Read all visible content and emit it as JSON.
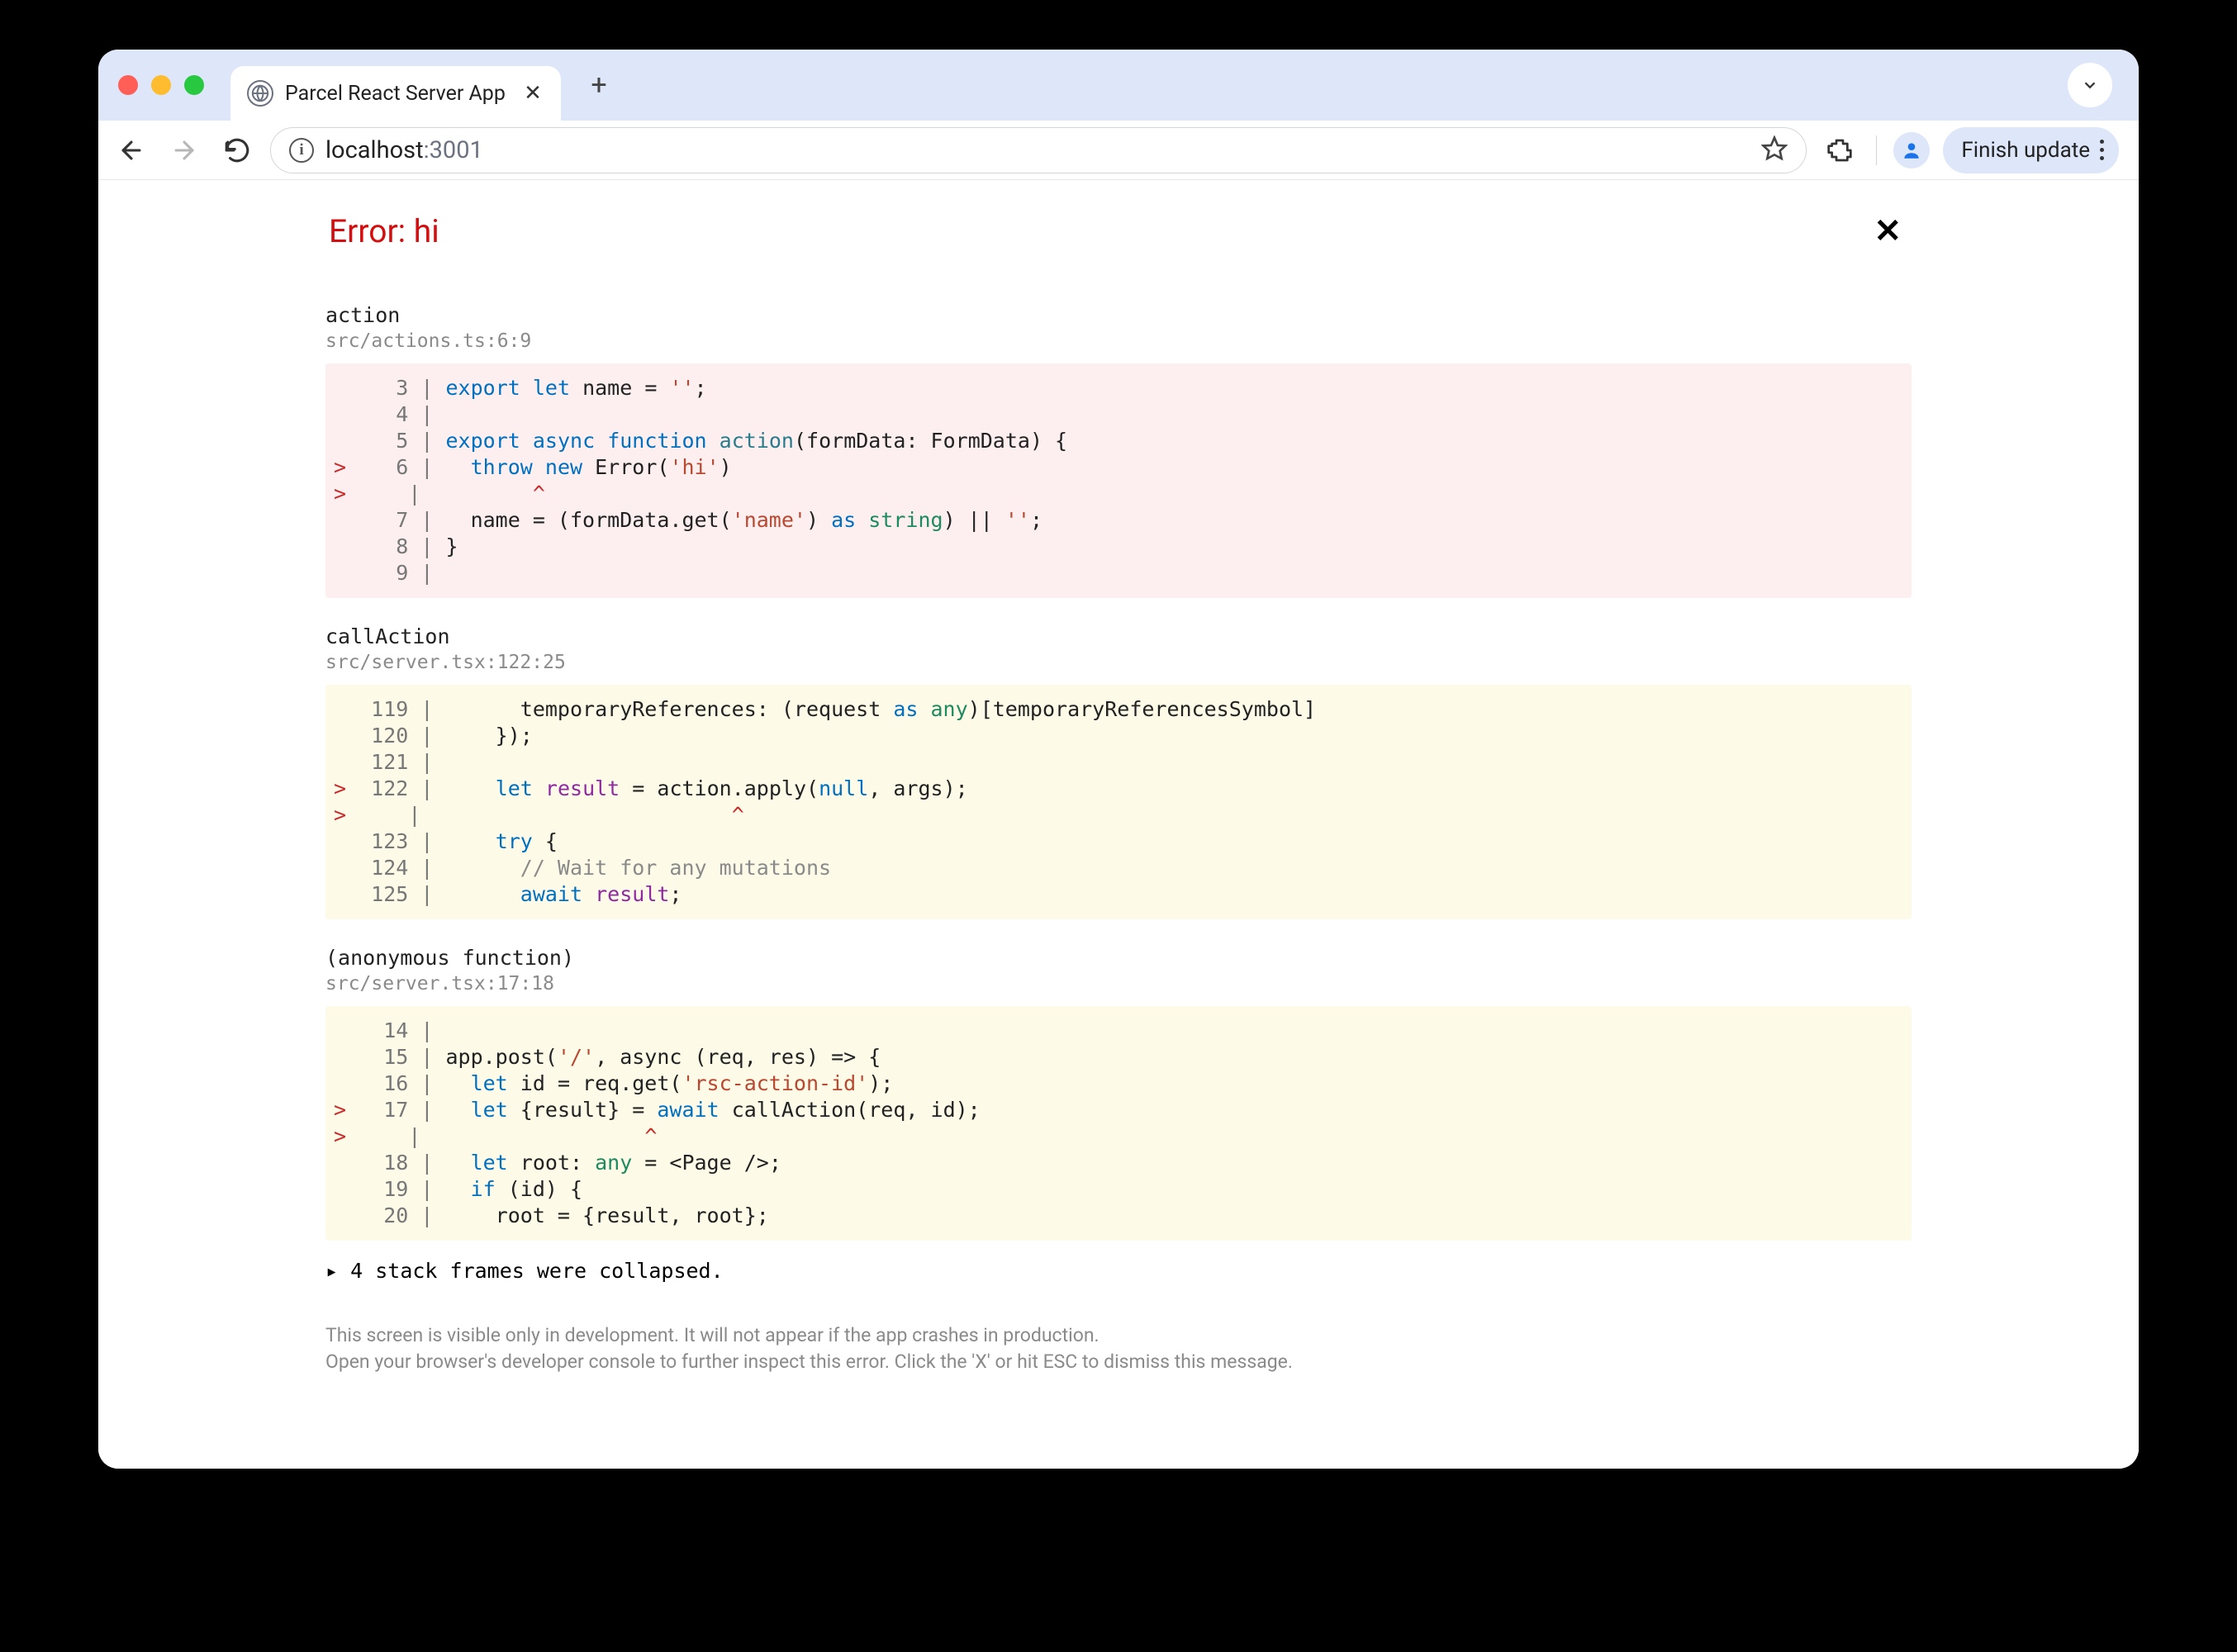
{
  "browser": {
    "tab_title": "Parcel React Server App",
    "url_host": "localhost",
    "url_port": ":3001",
    "finish_update": "Finish update"
  },
  "error": {
    "title": "Error: hi"
  },
  "frames": [
    {
      "name": "action",
      "loc": "src/actions.ts:6:9",
      "variant": "pink",
      "lines": [
        {
          "n": "3",
          "mark": " ",
          "tokens": [
            [
              "k-blue",
              "export"
            ],
            [
              "",
              " "
            ],
            [
              "k-blue",
              "let"
            ],
            [
              "",
              " name = "
            ],
            [
              "k-str",
              "''"
            ],
            [
              "",
              ";"
            ]
          ]
        },
        {
          "n": "4",
          "mark": " ",
          "tokens": []
        },
        {
          "n": "5",
          "mark": " ",
          "tokens": [
            [
              "k-blue",
              "export"
            ],
            [
              "",
              " "
            ],
            [
              "k-blue",
              "async"
            ],
            [
              "",
              " "
            ],
            [
              "k-blue",
              "function"
            ],
            [
              "",
              " "
            ],
            [
              "k-teal",
              "action"
            ],
            [
              "",
              "(formData: FormData) {"
            ]
          ]
        },
        {
          "n": "6",
          "mark": ">",
          "tokens": [
            [
              "",
              "  "
            ],
            [
              "k-blue",
              "throw"
            ],
            [
              "",
              " "
            ],
            [
              "k-blue",
              "new"
            ],
            [
              "",
              " Error("
            ],
            [
              "k-str",
              "'hi'"
            ],
            [
              "",
              ")"
            ]
          ]
        },
        {
          "caret": true,
          "col": 9
        },
        {
          "n": "7",
          "mark": " ",
          "tokens": [
            [
              "",
              "  name = (formData.get("
            ],
            [
              "k-str",
              "'name'"
            ],
            [
              "",
              ") "
            ],
            [
              "k-blue",
              "as"
            ],
            [
              "",
              " "
            ],
            [
              "k-any",
              "string"
            ],
            [
              "",
              ") || "
            ],
            [
              "k-str",
              "''"
            ],
            [
              "",
              ";"
            ]
          ]
        },
        {
          "n": "8",
          "mark": " ",
          "tokens": [
            [
              "",
              "}"
            ]
          ]
        },
        {
          "n": "9",
          "mark": " ",
          "tokens": []
        }
      ]
    },
    {
      "name": "callAction",
      "loc": "src/server.tsx:122:25",
      "variant": "yellow",
      "lines": [
        {
          "n": "119",
          "mark": " ",
          "tokens": [
            [
              "",
              "      temporaryReferences: (request "
            ],
            [
              "k-blue",
              "as"
            ],
            [
              "",
              " "
            ],
            [
              "k-any",
              "any"
            ],
            [
              "",
              ")[temporaryReferencesSymbol]"
            ]
          ]
        },
        {
          "n": "120",
          "mark": " ",
          "tokens": [
            [
              "",
              "    });"
            ]
          ]
        },
        {
          "n": "121",
          "mark": " ",
          "tokens": []
        },
        {
          "n": "122",
          "mark": ">",
          "tokens": [
            [
              "",
              "    "
            ],
            [
              "k-blue",
              "let"
            ],
            [
              "",
              " "
            ],
            [
              "k-purple",
              "result"
            ],
            [
              "",
              " = action.apply("
            ],
            [
              "k-blue",
              "null"
            ],
            [
              "",
              ", args);"
            ]
          ]
        },
        {
          "caret": true,
          "col": 25
        },
        {
          "n": "123",
          "mark": " ",
          "tokens": [
            [
              "",
              "    "
            ],
            [
              "k-blue",
              "try"
            ],
            [
              "",
              " {"
            ]
          ]
        },
        {
          "n": "124",
          "mark": " ",
          "tokens": [
            [
              "",
              "      "
            ],
            [
              "k-comment",
              "// Wait for any mutations"
            ]
          ]
        },
        {
          "n": "125",
          "mark": " ",
          "tokens": [
            [
              "",
              "      "
            ],
            [
              "k-blue",
              "await"
            ],
            [
              "",
              " "
            ],
            [
              "k-purple",
              "result"
            ],
            [
              "",
              ";"
            ]
          ]
        }
      ]
    },
    {
      "name": "(anonymous function)",
      "loc": "src/server.tsx:17:18",
      "variant": "yellow",
      "lines": [
        {
          "n": "14",
          "mark": " ",
          "tokens": []
        },
        {
          "n": "15",
          "mark": " ",
          "tokens": [
            [
              "",
              "app.post("
            ],
            [
              "k-str",
              "'/'"
            ],
            [
              "",
              ", async (req, res) => {"
            ]
          ]
        },
        {
          "n": "16",
          "mark": " ",
          "tokens": [
            [
              "",
              "  "
            ],
            [
              "k-blue",
              "let"
            ],
            [
              "",
              " id = req.get("
            ],
            [
              "k-str",
              "'rsc-action-id'"
            ],
            [
              "",
              ");"
            ]
          ]
        },
        {
          "n": "17",
          "mark": ">",
          "tokens": [
            [
              "",
              "  "
            ],
            [
              "k-blue",
              "let"
            ],
            [
              "",
              " {result} = "
            ],
            [
              "k-blue",
              "await"
            ],
            [
              "",
              " callAction(req, id);"
            ]
          ]
        },
        {
          "caret": true,
          "col": 18
        },
        {
          "n": "18",
          "mark": " ",
          "tokens": [
            [
              "",
              "  "
            ],
            [
              "k-blue",
              "let"
            ],
            [
              "",
              " root: "
            ],
            [
              "k-any",
              "any"
            ],
            [
              "",
              " = <Page />;"
            ]
          ]
        },
        {
          "n": "19",
          "mark": " ",
          "tokens": [
            [
              "",
              "  "
            ],
            [
              "k-blue",
              "if"
            ],
            [
              "",
              " (id) {"
            ]
          ]
        },
        {
          "n": "20",
          "mark": " ",
          "tokens": [
            [
              "",
              "    root = {result, root};"
            ]
          ]
        }
      ]
    }
  ],
  "collapsed": "4 stack frames were collapsed.",
  "footer": {
    "l1": "This screen is visible only in development. It will not appear if the app crashes in production.",
    "l2": "Open your browser's developer console to further inspect this error.  Click the 'X' or hit ESC to dismiss this message."
  }
}
